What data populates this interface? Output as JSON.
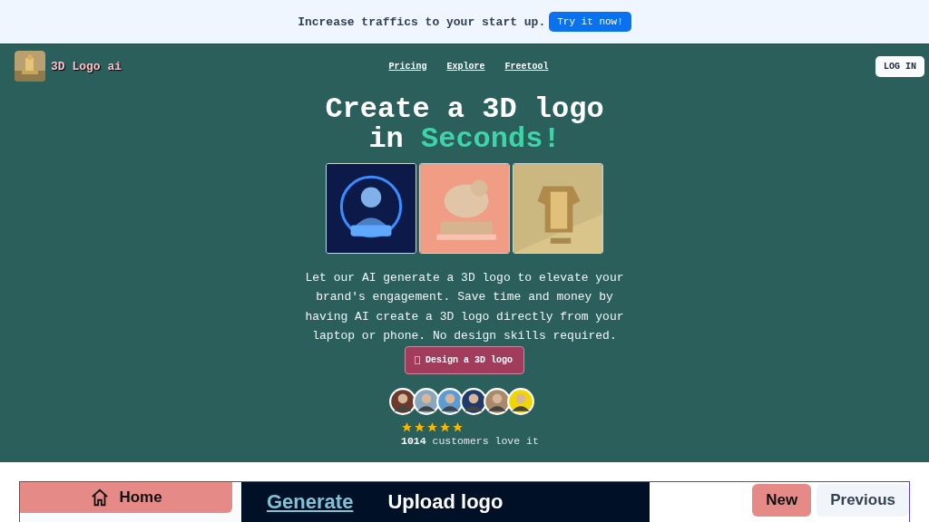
{
  "banner": {
    "text": "Increase traffics to your start up.",
    "button": "Try it now!"
  },
  "nav": {
    "brand": "3D Logo ai",
    "links": [
      "Pricing",
      "Explore",
      "Freetool"
    ],
    "login": "LOG IN"
  },
  "hero": {
    "title_line1": "Create a 3D logo",
    "title_line2_prefix": "in",
    "title_line2_accent": "Seconds!",
    "images": [
      {
        "kind": "picture"
      },
      {
        "kind": "picture"
      },
      {
        "kind": "picture"
      }
    ],
    "description": "Let our AI generate a 3D logo to elevate your brand's engagement. Save time and money by having AI create a 3D logo directly from your laptop or phone. No design skills required.",
    "cta": "Design a 3D logo",
    "stars": 5,
    "customers_count": "1014",
    "customers_text": "customers love it"
  },
  "preview": {
    "home": "Home",
    "tabs": [
      {
        "label": "Generate",
        "selected": true
      },
      {
        "label": "Upload logo",
        "selected": false
      }
    ],
    "buttons": [
      {
        "label": "New",
        "selected": true
      },
      {
        "label": "Previous",
        "selected": false
      }
    ]
  }
}
